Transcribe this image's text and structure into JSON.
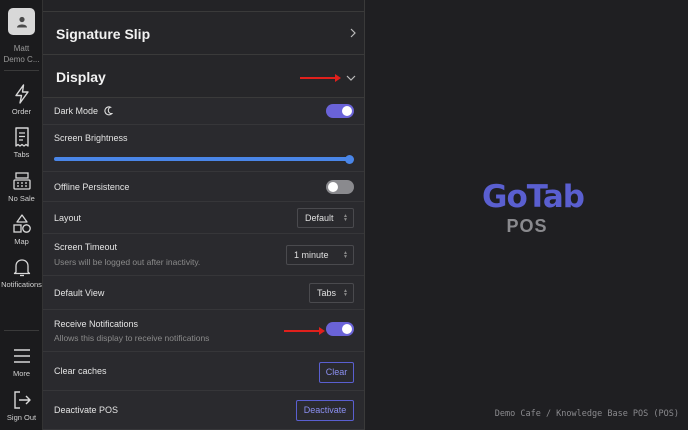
{
  "user": {
    "name": "Matt",
    "org": "Demo C..."
  },
  "nav": {
    "order": "Order",
    "tabs": "Tabs",
    "no_sale": "No Sale",
    "map": "Map",
    "notifications": "Notifications",
    "more": "More",
    "sign_out": "Sign Out"
  },
  "sections": {
    "signature_slip": "Signature Slip",
    "display": "Display"
  },
  "settings": {
    "dark_mode": {
      "label": "Dark Mode",
      "enabled": true
    },
    "brightness": {
      "label": "Screen Brightness",
      "level": 1.0
    },
    "offline_persistence": {
      "label": "Offline Persistence",
      "enabled": false
    },
    "layout": {
      "label": "Layout",
      "value": "Default"
    },
    "screen_timeout": {
      "label": "Screen Timeout",
      "sub": "Users will be logged out after inactivity.",
      "value": "1 minute"
    },
    "default_view": {
      "label": "Default View",
      "value": "Tabs"
    },
    "receive_notifications": {
      "label": "Receive Notifications",
      "sub": "Allows this display to receive notifications",
      "enabled": true
    },
    "clear_caches": {
      "label": "Clear caches",
      "button": "Clear"
    },
    "deactivate_pos": {
      "label": "Deactivate POS",
      "button": "Deactivate"
    }
  },
  "brand": {
    "logo_text": "GoTab",
    "product": "POS"
  },
  "footer": "Demo Cafe / Knowledge Base POS (POS)",
  "colors": {
    "accent": "#6a63d8",
    "slider": "#4a86e8",
    "annotation_arrow": "#e0201c",
    "logo": "#5a5fd0"
  }
}
